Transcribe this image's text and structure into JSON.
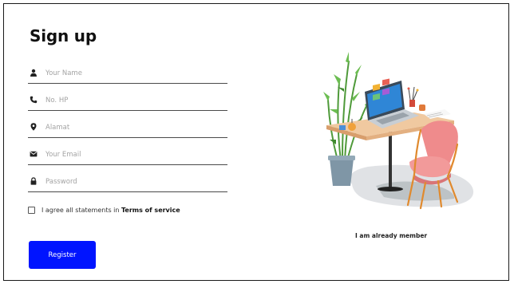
{
  "form": {
    "title": "Sign up",
    "fields": [
      {
        "icon": "person-icon",
        "placeholder": "Your Name",
        "value": ""
      },
      {
        "icon": "phone-icon",
        "placeholder": "No. HP",
        "value": ""
      },
      {
        "icon": "location-pin-icon",
        "placeholder": "Alamat",
        "value": ""
      },
      {
        "icon": "envelope-icon",
        "placeholder": "Your Email",
        "value": ""
      },
      {
        "icon": "lock-icon",
        "placeholder": "Password",
        "value": ""
      }
    ],
    "agree_text": "I agree all statements in ",
    "terms_link": "Terms of service",
    "agree_checked": false,
    "register_label": "Register"
  },
  "side": {
    "illustration": "workspace-desk-chair-laptop-plant",
    "member_link": "I am already member"
  },
  "colors": {
    "primary_button": "#0014ff",
    "border": "#1a1a1a",
    "text": "#111111",
    "placeholder": "#a3a3a3"
  }
}
